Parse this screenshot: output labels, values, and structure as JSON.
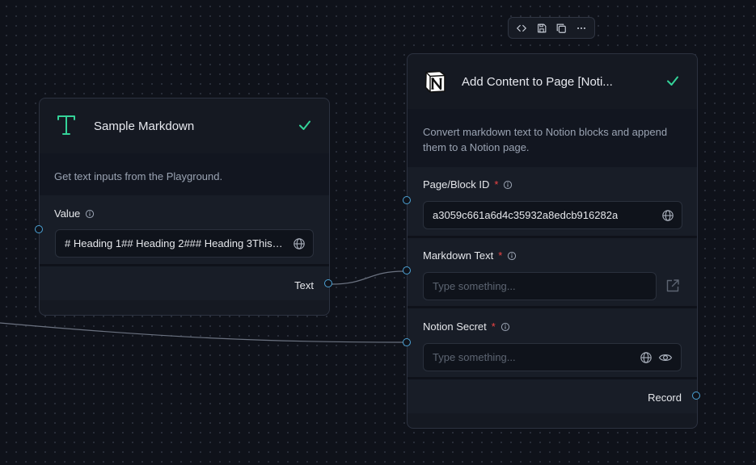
{
  "toolbar": {
    "buttons": [
      {
        "icon": "code-icon"
      },
      {
        "icon": "save-icon"
      },
      {
        "icon": "duplicate-icon"
      },
      {
        "icon": "more-icon"
      }
    ]
  },
  "node_left": {
    "title": "Sample Markdown",
    "icon": "text-t-icon",
    "description": "Get text inputs from the Playground.",
    "field": {
      "label": "Value",
      "value": "# Heading 1## Heading 2### Heading 3This i..."
    },
    "output": {
      "label": "Text"
    }
  },
  "node_right": {
    "title": "Add Content to Page [Noti...",
    "icon": "notion-logo-icon",
    "description": "Convert markdown text to Notion blocks and append them to a Notion page.",
    "fields": [
      {
        "label": "Page/Block ID",
        "required": "*",
        "value": "a3059c661a6d4c35932a8edcb916282a"
      },
      {
        "label": "Markdown Text",
        "required": "*",
        "placeholder": "Type something..."
      },
      {
        "label": "Notion Secret",
        "required": "*",
        "placeholder": "Type something..."
      }
    ],
    "output": {
      "label": "Record"
    }
  },
  "colors": {
    "background": "#0f121a",
    "node": "#151922",
    "check": "#34d399",
    "handle": "#4ca3d6",
    "required": "#ef4444",
    "accent_t": "#34d399"
  }
}
